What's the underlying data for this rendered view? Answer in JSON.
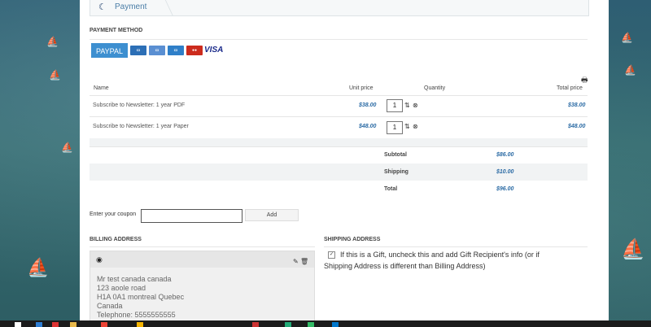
{
  "steps": {
    "current_label": "Payment"
  },
  "payment_method": {
    "title": "PAYMENT METHOD",
    "paypal_label": "PAYPAL",
    "cards": [
      {
        "name": "card-generic-icon",
        "color": "#2c6fb6"
      },
      {
        "name": "card-discover-icon",
        "color": "#5a8fd2"
      },
      {
        "name": "card-amex-icon",
        "color": "#2f7fc8"
      },
      {
        "name": "card-mastercard-icon",
        "color": "#cc2b1d"
      }
    ],
    "visa_label": "VISA"
  },
  "cart": {
    "headers": {
      "name": "Name",
      "unit_price": "Unit price",
      "quantity": "Quantity",
      "total_price": "Total price"
    },
    "rows": [
      {
        "name": "Subscribe to Newsletter: 1 year PDF",
        "unit_price": "$38.00",
        "quantity": "1",
        "total": "$38.00"
      },
      {
        "name": "Subscribe to Newsletter: 1 year Paper",
        "unit_price": "$48.00",
        "quantity": "1",
        "total": "$48.00"
      }
    ],
    "summary": {
      "subtotal_label": "Subtotal",
      "subtotal": "$86.00",
      "shipping_label": "Shipping",
      "shipping": "$10.00",
      "total_label": "Total",
      "total": "$96.00"
    }
  },
  "coupon": {
    "label": "Enter your coupon",
    "value": "",
    "add_label": "Add"
  },
  "billing": {
    "title": "BILLING ADDRESS",
    "lines": [
      "Mr test canada canada",
      "123 aoole road",
      "H1A 0A1 montreal Quebec",
      "Canada",
      "Telephone: 5555555555"
    ]
  },
  "shipping": {
    "title": "SHIPPING ADDRESS",
    "gift_text": "If this is a Gift, uncheck this and add Gift Recipient's info (or if Shipping Address is different than Billing Address)"
  },
  "colors": {
    "accent": "#3d8fd0",
    "price": "#2a6aa4"
  }
}
